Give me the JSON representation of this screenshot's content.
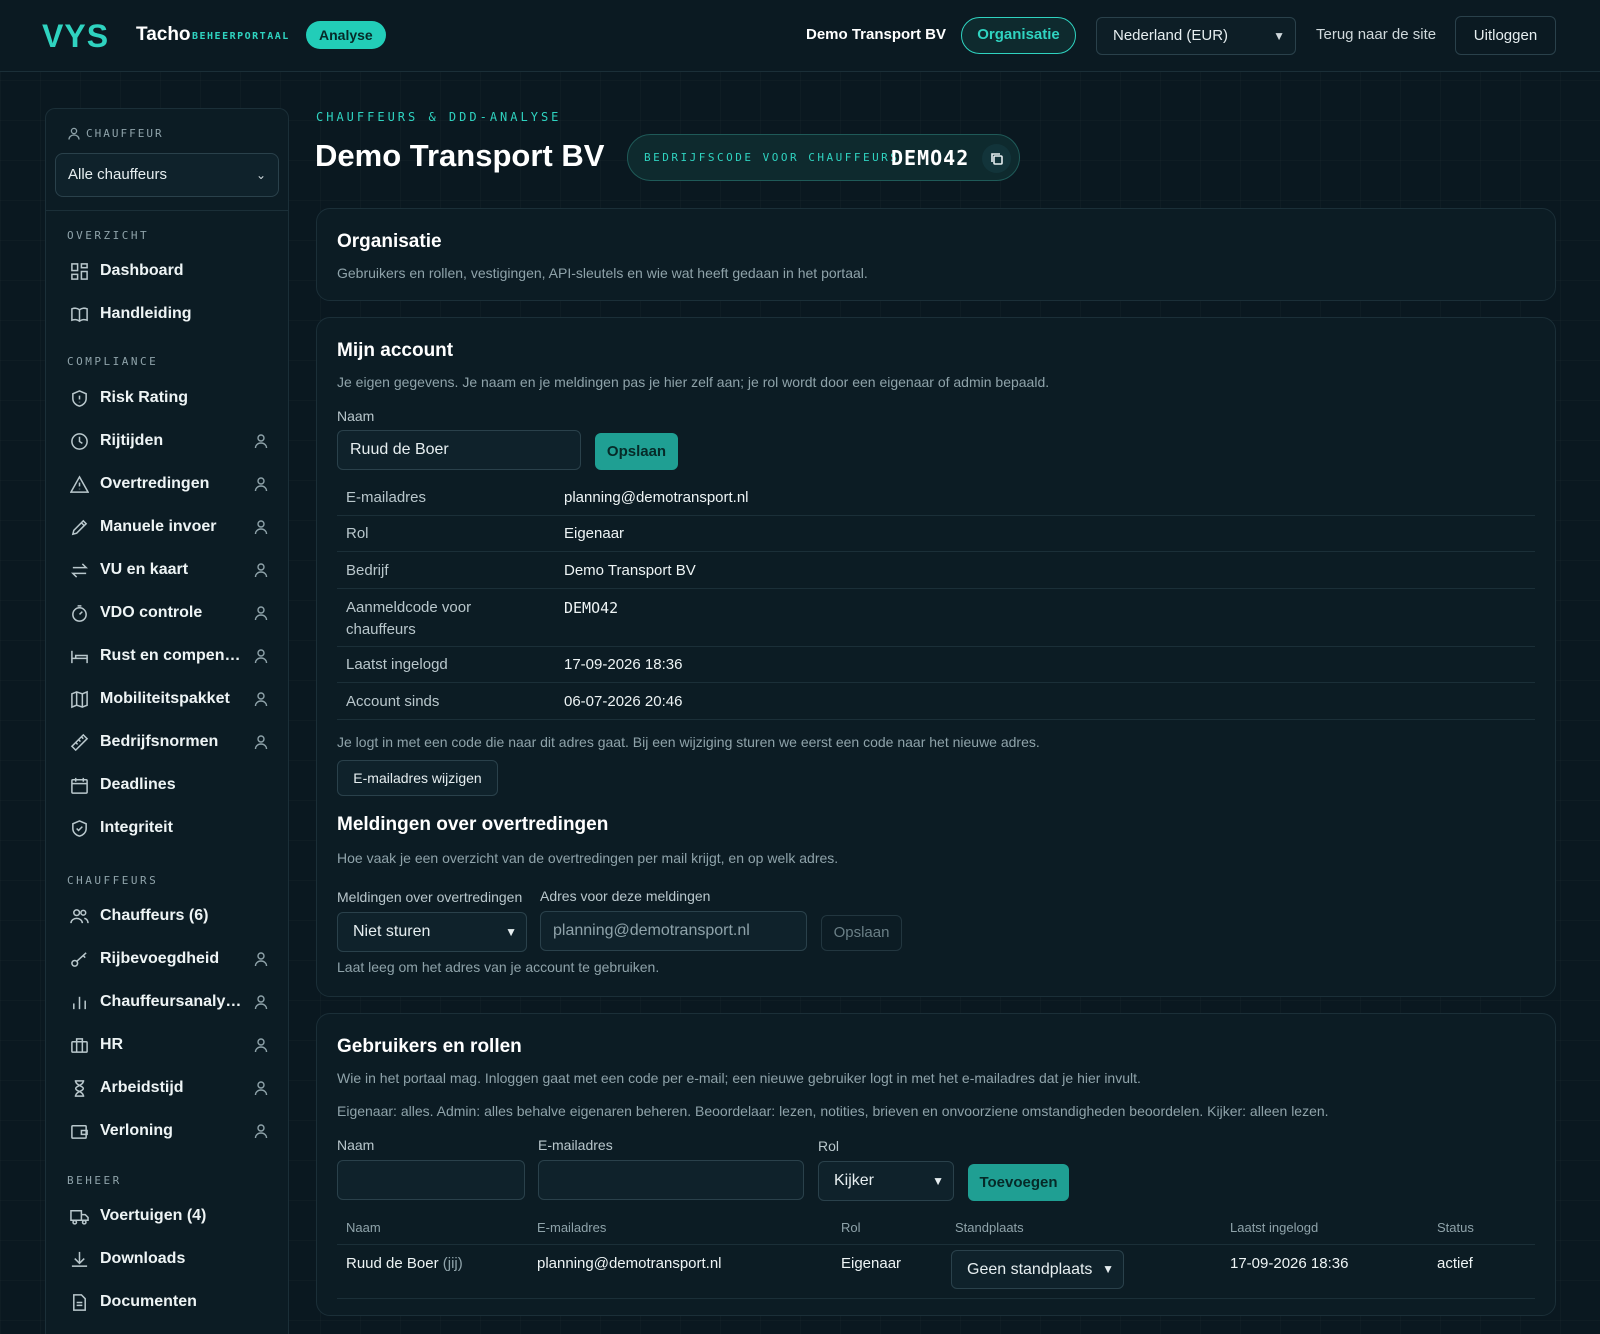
{
  "topbar": {
    "logo": "VYS",
    "brand_name": "Tacho",
    "brand_sub": "BEHEERPORTAAL",
    "badge": "Analyse",
    "org_name": "Demo Transport BV",
    "org_button": "Organisatie",
    "country_select": "Nederland (EUR)",
    "back_link": "Terug naar de site",
    "logout": "Uitloggen"
  },
  "sidebar": {
    "driver_label": "CHAUFFEUR",
    "driver_select": "Alle chauffeurs",
    "sections": [
      {
        "label": "OVERZICHT"
      },
      {
        "label": "COMPLIANCE"
      },
      {
        "label": "CHAUFFEURS"
      },
      {
        "label": "BEHEER"
      }
    ],
    "items": [
      {
        "label": "Dashboard",
        "icon": "dashboard-icon"
      },
      {
        "label": "Handleiding",
        "icon": "book-icon"
      },
      {
        "label": "Risk Rating",
        "icon": "shield-icon"
      },
      {
        "label": "Rijtijden",
        "icon": "clock-icon"
      },
      {
        "label": "Overtredingen",
        "icon": "warning-icon"
      },
      {
        "label": "Manuele invoer",
        "icon": "pencil-icon"
      },
      {
        "label": "VU en kaart",
        "icon": "transfer-icon"
      },
      {
        "label": "VDO controle",
        "icon": "stopwatch-icon"
      },
      {
        "label": "Rust en compen…",
        "icon": "bed-icon"
      },
      {
        "label": "Mobiliteitspakket",
        "icon": "map-icon"
      },
      {
        "label": "Bedrijfsnormen",
        "icon": "ruler-icon"
      },
      {
        "label": "Deadlines",
        "icon": "calendar-icon"
      },
      {
        "label": "Integriteit",
        "icon": "shield-check-icon"
      },
      {
        "label": "Chauffeurs (6)",
        "icon": "users-icon"
      },
      {
        "label": "Rijbevoegdheid",
        "icon": "key-icon"
      },
      {
        "label": "Chauffeursanaly…",
        "icon": "bar-chart-icon"
      },
      {
        "label": "HR",
        "icon": "briefcase-icon"
      },
      {
        "label": "Arbeidstijd",
        "icon": "hourglass-icon"
      },
      {
        "label": "Verloning",
        "icon": "wallet-icon"
      },
      {
        "label": "Voertuigen (4)",
        "icon": "truck-icon"
      },
      {
        "label": "Downloads",
        "icon": "download-icon"
      },
      {
        "label": "Documenten",
        "icon": "document-icon"
      }
    ]
  },
  "header": {
    "eyebrow": "CHAUFFEURS & DDD-ANALYSE",
    "title": "Demo Transport BV",
    "code_label": "BEDRIJFSCODE VOOR CHAUFFEURS",
    "code": "DEMO42"
  },
  "org_card": {
    "title": "Organisatie",
    "desc": "Gebruikers en rollen, vestigingen, API-sleutels en wie wat heeft gedaan in het portaal."
  },
  "account": {
    "title": "Mijn account",
    "desc": "Je eigen gegevens. Je naam en je meldingen pas je hier zelf aan; je rol wordt door een eigenaar of admin bepaald.",
    "name_label": "Naam",
    "name_value": "Ruud de Boer",
    "save": "Opslaan",
    "rows": [
      {
        "key": "E-mailadres",
        "value": "planning@demotransport.nl"
      },
      {
        "key": "Rol",
        "value": "Eigenaar"
      },
      {
        "key": "Bedrijf",
        "value": "Demo Transport BV"
      },
      {
        "key": "Aanmeldcode voor chauffeurs",
        "value": "DEMO42"
      },
      {
        "key": "Laatst ingelogd",
        "value": "17-09-2026 18:36"
      },
      {
        "key": "Account sinds",
        "value": "06-07-2026 20:46"
      }
    ],
    "login_note": "Je logt in met een code die naar dit adres gaat. Bij een wijziging sturen we eerst een code naar het nieuwe adres.",
    "change_email": "E-mailadres wijzigen",
    "notif_title": "Meldingen over overtredingen",
    "notif_desc": "Hoe vaak je een overzicht van de overtredingen per mail krijgt, en op welk adres.",
    "notif_freq_label": "Meldingen over overtredingen",
    "notif_freq_value": "Niet sturen",
    "notif_addr_label": "Adres voor deze meldingen",
    "notif_addr_placeholder": "planning@demotransport.nl",
    "notif_save": "Opslaan",
    "notif_hint": "Laat leeg om het adres van je account te gebruiken."
  },
  "users": {
    "title": "Gebruikers en rollen",
    "desc1": "Wie in het portaal mag. Inloggen gaat met een code per e-mail; een nieuwe gebruiker logt in met het e-mailadres dat je hier invult.",
    "desc2": "Eigenaar: alles. Admin: alles behalve eigenaren beheren. Beoordelaar: lezen, notities, brieven en onvoorziene omstandigheden beoordelen. Kijker: alleen lezen.",
    "name_label": "Naam",
    "email_label": "E-mailadres",
    "role_label": "Rol",
    "role_value": "Kijker",
    "add": "Toevoegen",
    "columns": [
      "Naam",
      "E-mailadres",
      "Rol",
      "Standplaats",
      "Laatst ingelogd",
      "Status"
    ],
    "rows": [
      {
        "name": "Ruud de Boer",
        "you": "(jij)",
        "email": "planning@demotransport.nl",
        "role": "Eigenaar",
        "location": "Geen standplaats",
        "last_login": "17-09-2026 18:36",
        "status": "actief"
      }
    ]
  },
  "colors": {
    "accent": "#2fd3c0",
    "background": "#0a1820",
    "card": "#0c1c24",
    "primary_button": "#1f9f93"
  }
}
